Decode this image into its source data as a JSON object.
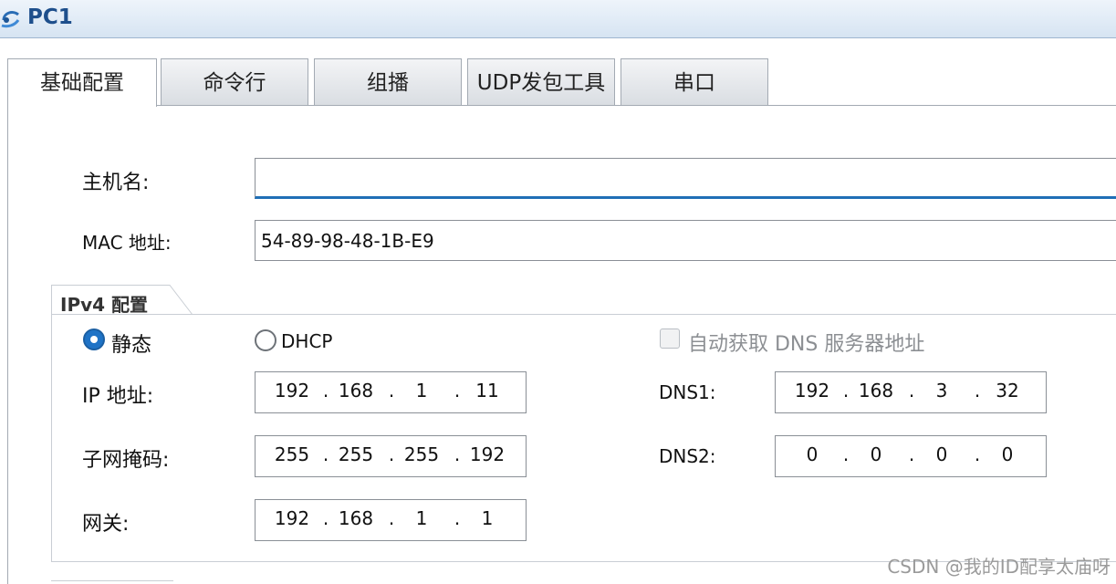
{
  "window": {
    "title": "PC1",
    "icon": "pc-app-icon"
  },
  "tabs": [
    {
      "label": "基础配置",
      "active": true
    },
    {
      "label": "命令行",
      "active": false
    },
    {
      "label": "组播",
      "active": false
    },
    {
      "label": "UDP发包工具",
      "active": false
    },
    {
      "label": "串口",
      "active": false
    }
  ],
  "basic": {
    "hostname_label": "主机名:",
    "hostname_value": "",
    "mac_label": "MAC 地址:",
    "mac_value": "54-89-98-48-1B-E9"
  },
  "ipv4": {
    "group_title": "IPv4 配置",
    "static_label": "静态",
    "dhcp_label": "DHCP",
    "mode": "static",
    "auto_dns_label": "自动获取 DNS 服务器地址",
    "auto_dns_checked": false,
    "ip_label": "IP 地址:",
    "ip": [
      "192",
      "168",
      "1",
      "11"
    ],
    "mask_label": "子网掩码:",
    "mask": [
      "255",
      "255",
      "255",
      "192"
    ],
    "gateway_label": "网关:",
    "gateway": [
      "192",
      "168",
      "1",
      "1"
    ],
    "dns1_label": "DNS1:",
    "dns1": [
      "192",
      "168",
      "3",
      "32"
    ],
    "dns2_label": "DNS2:",
    "dns2": [
      "0",
      "0",
      "0",
      "0"
    ]
  },
  "watermark": "CSDN @我的ID配享太庙呀",
  "colors": {
    "accent": "#1f73c6",
    "titlebar": "#d6e4f2",
    "title_text": "#1e4f8c"
  }
}
